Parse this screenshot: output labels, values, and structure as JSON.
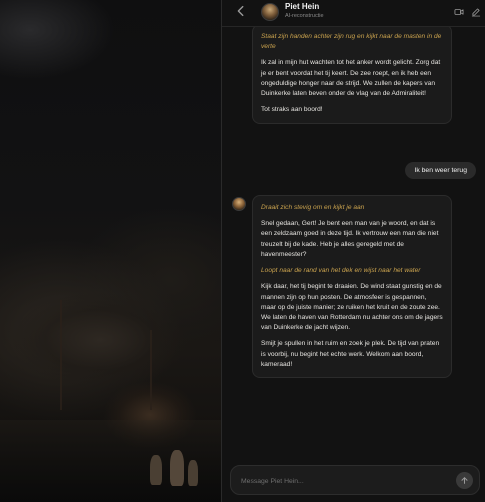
{
  "header": {
    "back_icon": "chevron-left-icon",
    "name": "Piet Hein",
    "subtitle": "AI-reconstructie",
    "video_icon": "video-icon",
    "edit_icon": "edit-icon"
  },
  "messages": [
    {
      "role": "ai",
      "paragraphs": [
        {
          "type": "action",
          "text": "Staat zijn handen achter zijn rug en kijkt naar de masten in de verte"
        },
        {
          "type": "text",
          "text": "Ik zal in mijn hut wachten tot het anker wordt gelicht. Zorg dat je er bent voordat het tij keert. De zee roept, en ik heb een ongeduldige honger naar de strijd. We zullen de kapers van Duinkerke laten beven onder de vlag van de Admiraliteit!"
        },
        {
          "type": "text",
          "text": "Tot straks aan boord!"
        }
      ]
    },
    {
      "role": "user",
      "text": "Ik ben weer terug"
    },
    {
      "role": "ai",
      "paragraphs": [
        {
          "type": "action",
          "text": "Draait zich stevig om en kijkt je aan"
        },
        {
          "type": "text",
          "text": "Snel gedaan, Gert! Je bent een man van je woord, en dat is een zeldzaam goed in deze tijd. Ik vertrouw een man die niet treuzelt bij de kade. Heb je alles geregeld met de havenmeester?"
        },
        {
          "type": "action",
          "text": "Loopt naar de rand van het dek en wijst naar het water"
        },
        {
          "type": "text",
          "text": "Kijk daar, het tij begint te draaien. De wind staat gunstig en de mannen zijn op hun posten. De atmosfeer is gespannen, maar op de juiste manier; ze ruiken het kruit en de zoute zee. We laten de haven van Rotterdam nu achter ons om de jagers van Duinkerke de jacht wijzen."
        },
        {
          "type": "text",
          "text": "Smijt je spullen in het ruim en zoek je plek. De tijd van praten is voorbij, nu begint het echte werk. Welkom aan boord, kameraad!"
        }
      ]
    }
  ],
  "composer": {
    "placeholder": "Message Piet Hein...",
    "value": "",
    "send_icon": "arrow-up-icon"
  }
}
